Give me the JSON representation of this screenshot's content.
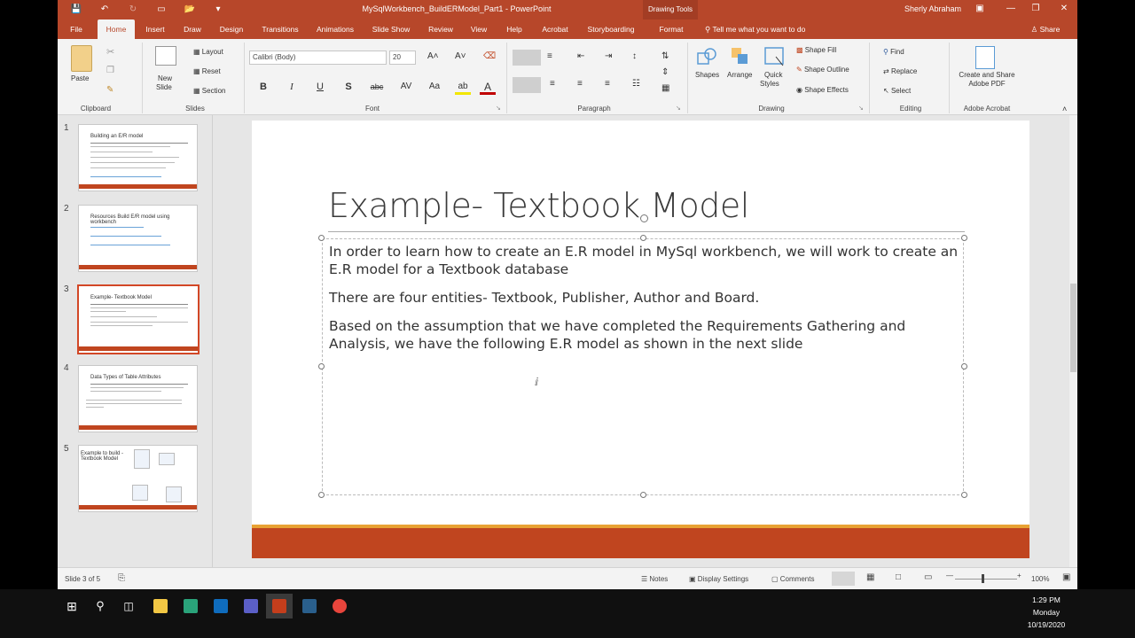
{
  "window": {
    "title": "MySqlWorkbench_BuildERModel_Part1  -  PowerPoint",
    "contextual_tab_group": "Drawing Tools",
    "user": "Sherly Abraham"
  },
  "tabs": [
    "File",
    "Home",
    "Insert",
    "Draw",
    "Design",
    "Transitions",
    "Animations",
    "Slide Show",
    "Review",
    "View",
    "Help",
    "Acrobat",
    "Storyboarding",
    "Format"
  ],
  "tell_me": "Tell me what you want to do",
  "share": "Share",
  "ribbon": {
    "clipboard": {
      "label": "Clipboard",
      "paste": "Paste"
    },
    "slides": {
      "label": "Slides",
      "new_slide": "New",
      "new_slide2": "Slide",
      "layout": "Layout",
      "reset": "Reset",
      "section": "Section"
    },
    "font": {
      "label": "Font",
      "font_name": "Calibri (Body)",
      "font_size": "20"
    },
    "paragraph": {
      "label": "Paragraph"
    },
    "drawing": {
      "label": "Drawing",
      "shapes": "Shapes",
      "arrange": "Arrange",
      "quick_styles": "Quick",
      "quick_styles2": "Styles",
      "shape_fill": "Shape Fill",
      "shape_outline": "Shape Outline",
      "shape_effects": "Shape Effects"
    },
    "editing": {
      "label": "Editing",
      "find": "Find",
      "replace": "Replace",
      "select": "Select"
    },
    "acrobat": {
      "label": "Adobe Acrobat",
      "create1": "Create and Share",
      "create2": "Adobe PDF"
    }
  },
  "thumbnails": [
    {
      "num": "1",
      "title": "Building an E/R model"
    },
    {
      "num": "2",
      "title": "Resources Build E/R model using workbench"
    },
    {
      "num": "3",
      "title": "Example- Textbook Model"
    },
    {
      "num": "4",
      "title": "Data Types of Table Attributes"
    },
    {
      "num": "5",
      "title": "Example to build - Textbook Model"
    }
  ],
  "slide": {
    "title": "Example- Textbook Model",
    "paragraphs": [
      "In order to learn how to create an E.R model in MySql workbench, we will work to create an E.R model for a Textbook database",
      "There are four entities- Textbook, Publisher, Author and Board.",
      "Based on the assumption that we have completed the Requirements Gathering and Analysis, we have the following E.R model as shown in the next slide"
    ]
  },
  "status": {
    "slide_count": "Slide 3 of 5",
    "notes": "Notes",
    "display_settings": "Display Settings",
    "comments": "Comments",
    "zoom": "100%"
  },
  "clock": {
    "time": "1:29 PM",
    "day": "Monday",
    "date": "10/19/2020"
  },
  "colors": {
    "accent": "#b7472a",
    "slide_bar": "#c0451f",
    "slide_bar_top": "#e8a233"
  }
}
